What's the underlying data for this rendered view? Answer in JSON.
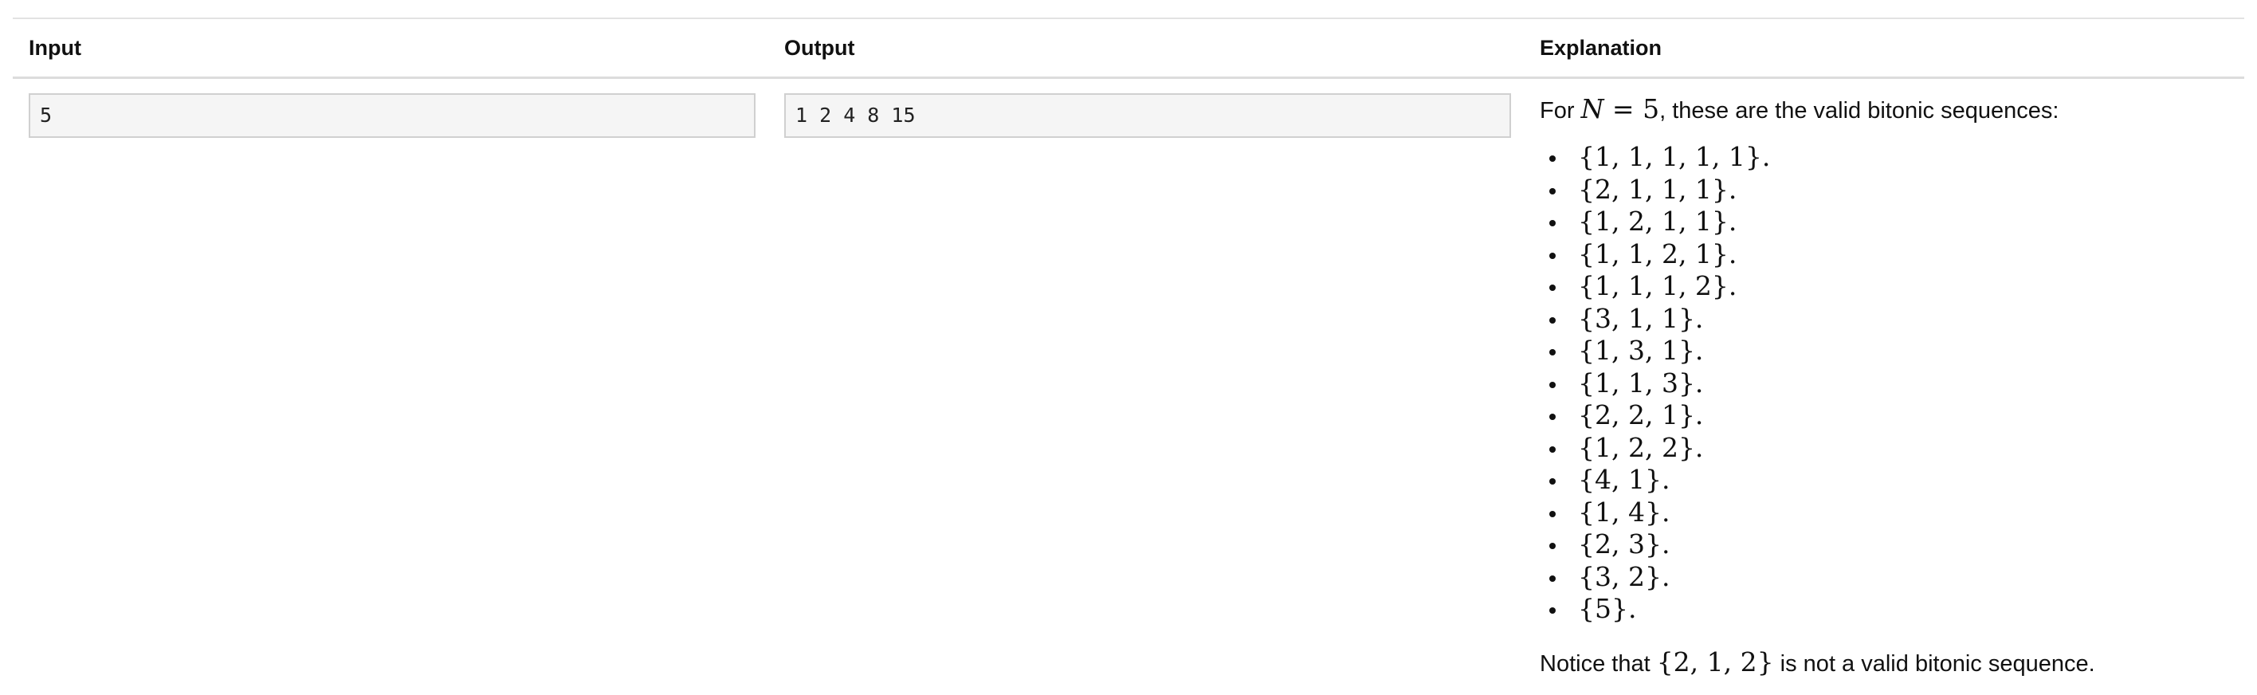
{
  "table": {
    "headers": {
      "input": "Input",
      "output": "Output",
      "explanation": "Explanation"
    },
    "input_value": "5",
    "output_value": "1 2 4 8 15",
    "explanation": {
      "intro_prefix": "For ",
      "intro_var": "N",
      "intro_eq": " = 5",
      "intro_suffix": ", these are the valid bitonic sequences:",
      "sequences": [
        "{1, 1, 1, 1, 1}.",
        "{2, 1, 1, 1}.",
        "{1, 2, 1, 1}.",
        "{1, 1, 2, 1}.",
        "{1, 1, 1, 2}.",
        "{3, 1, 1}.",
        "{1, 3, 1}.",
        "{1, 1, 3}.",
        "{2, 2, 1}.",
        "{1, 2, 2}.",
        "{4, 1}.",
        "{1, 4}.",
        "{2, 3}.",
        "{3, 2}.",
        "{5}."
      ],
      "notice_prefix": "Notice that ",
      "notice_seq": "{2, 1, 2}",
      "notice_suffix": " is not a valid bitonic sequence."
    }
  }
}
